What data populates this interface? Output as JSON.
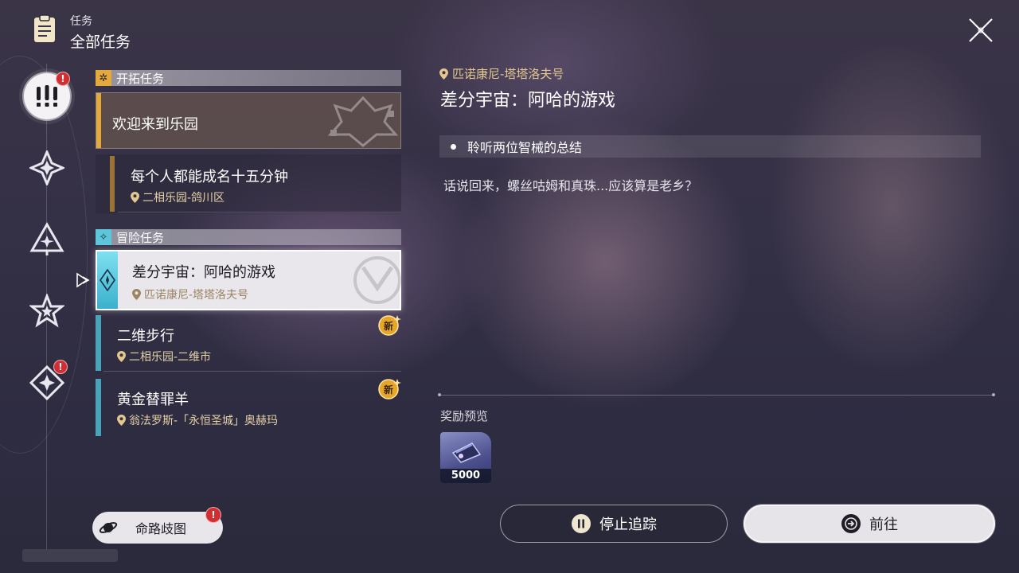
{
  "header": {
    "section": "任务",
    "title": "全部任务"
  },
  "categories": [
    {
      "id": "all",
      "icon": "exclamation-icon",
      "badge": "!",
      "active": true
    },
    {
      "id": "trailblaze",
      "icon": "four-point-star-icon",
      "badge": "",
      "active": false
    },
    {
      "id": "companion",
      "icon": "triangle-star-icon",
      "badge": "",
      "active": false
    },
    {
      "id": "daily",
      "icon": "star-icon",
      "badge": "",
      "active": false
    },
    {
      "id": "event",
      "icon": "diamond-star-icon",
      "badge": "!",
      "active": false
    }
  ],
  "sections": {
    "trailblaze": {
      "label": "开拓任务",
      "quests": [
        {
          "title": "欢迎来到乐园",
          "location": ""
        },
        {
          "title": "每个人都能成名十五分钟",
          "location": "二相乐园-鸽川区"
        }
      ]
    },
    "adventure": {
      "label": "冒险任务",
      "quests": [
        {
          "title": "差分宇宙：阿哈的游戏",
          "location": "匹诺康尼-塔塔洛夫号",
          "selected": true,
          "new": ""
        },
        {
          "title": "二维步行",
          "location": "二相乐园-二维市",
          "new": "新"
        },
        {
          "title": "黄金替罪羊",
          "location": "翁法罗斯-「永恒圣城」奥赫玛",
          "new": "新"
        }
      ]
    }
  },
  "detail": {
    "location": "匹诺康尼-塔塔洛夫号",
    "title": "差分宇宙：阿哈的游戏",
    "step": "聆听两位智械的总结",
    "description": "话说回来，螺丝咕姆和真珠...应该算是老乡？",
    "reward_label": "奖励预览",
    "rewards": [
      {
        "icon": "credit-card-icon",
        "qty": "5000"
      }
    ]
  },
  "buttons": {
    "stop": "停止追踪",
    "go": "前往",
    "map": "命路歧图",
    "map_badge": "!"
  },
  "colors": {
    "trailblaze_accent": "#e3a93a",
    "adventure_accent": "#4aa3b8",
    "location_gold": "#e4c88f",
    "badge_red": "#d22e32"
  }
}
